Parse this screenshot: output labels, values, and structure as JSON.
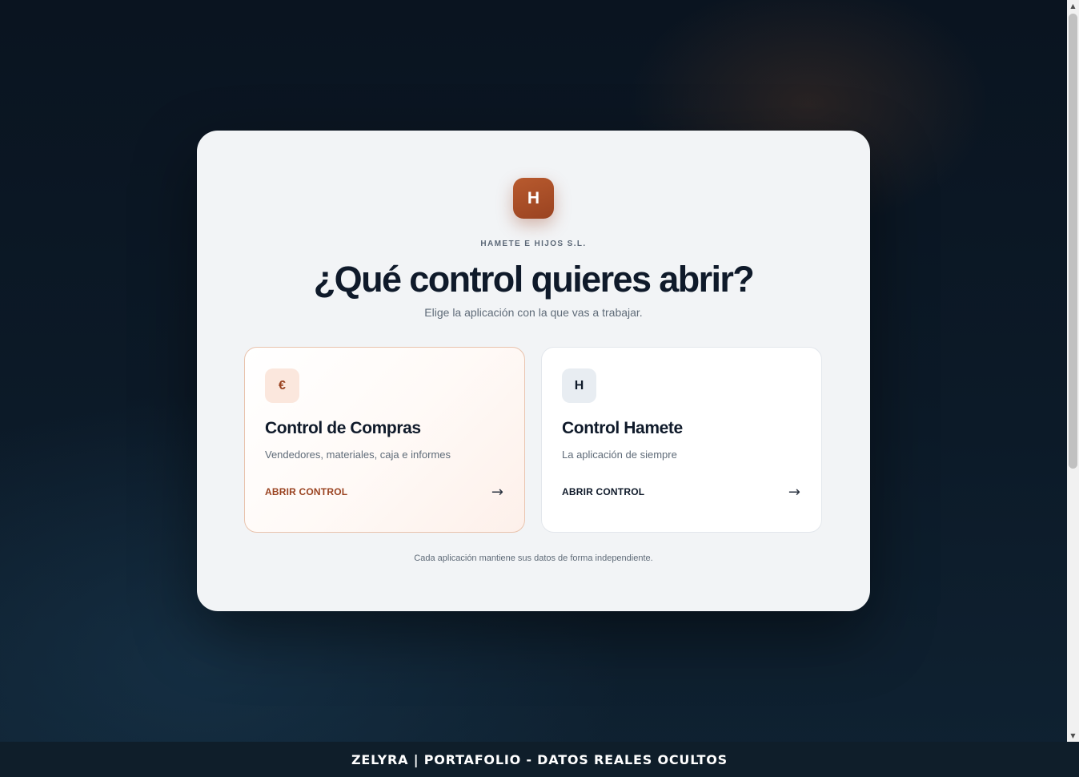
{
  "logo": {
    "letter": "H"
  },
  "header": {
    "company": "HAMETE E HIJOS S.L.",
    "title": "¿Qué control quieres abrir?",
    "subtitle": "Elige la aplicación con la que vas a trabajar."
  },
  "apps": [
    {
      "icon": "€",
      "icon_name": "euro-icon",
      "name": "Control de Compras",
      "description": "Vendedores, materiales, caja e informes",
      "action": "ABRIR CONTROL",
      "arrow": "→",
      "accent": "#9a4321"
    },
    {
      "icon": "H",
      "icon_name": "h-letter-icon",
      "name": "Control Hamete",
      "description": "La aplicación de siempre",
      "action": "ABRIR CONTROL",
      "arrow": "→",
      "accent": "#0f1a2a"
    }
  ],
  "footnote": "Cada aplicación mantiene sus datos de forma independiente.",
  "banner": "ZELYRA | PORTAFOLIO - DATOS REALES OCULTOS",
  "colors": {
    "brand": "#9a4321",
    "card_background": "#f2f4f6",
    "page_background": "#0c1a28"
  }
}
